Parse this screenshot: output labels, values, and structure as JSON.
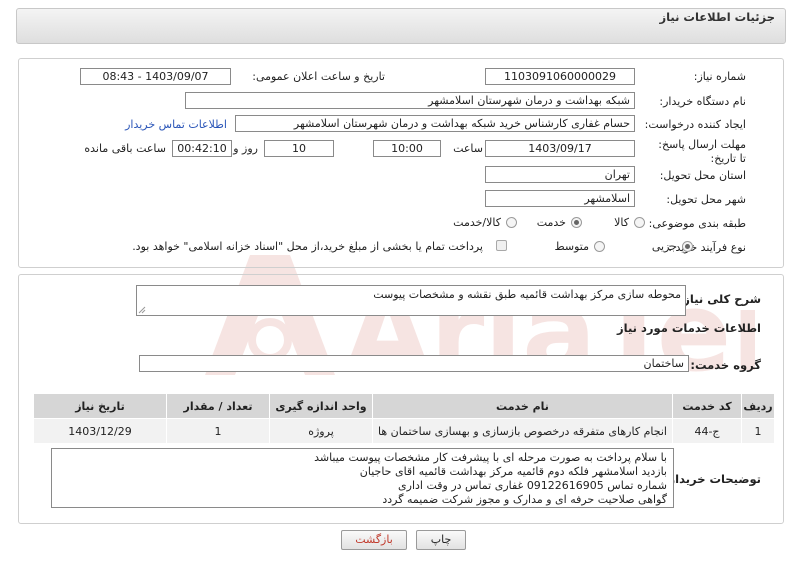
{
  "header": {
    "title": "جزئیات اطلاعات نیاز"
  },
  "form": {
    "need_number_label": "شماره نیاز:",
    "need_number": "1103091060000029",
    "announce_label": "تاریخ و ساعت اعلان عمومی:",
    "announce_value": "1403/09/07 - 08:43",
    "buyer_label": "نام دستگاه خریدار:",
    "buyer_value": "شبکه بهداشت و درمان شهرستان اسلامشهر",
    "creator_label": "ایجاد کننده درخواست:",
    "creator_value": "حسام غفاری کارشناس خرید شبکه بهداشت و درمان شهرستان اسلامشهر",
    "contact_link": "اطلاعات تماس خریدار",
    "deadline_label": "مهلت ارسال پاسخ: تا تاریخ:",
    "deadline_date": "1403/09/17",
    "time_label": "ساعت",
    "deadline_time": "10:00",
    "days_value": "10",
    "days_label": "روز و",
    "remaining_value": "00:42:10",
    "remaining_label": "ساعت باقی مانده",
    "province_label": "استان محل تحویل:",
    "province_value": "تهران",
    "city_label": "شهر محل تحویل:",
    "city_value": "اسلامشهر",
    "category_label": "طبقه بندی موضوعی:",
    "category_options": [
      "کالا",
      "خدمت",
      "کالا/خدمت"
    ],
    "category_selected": "خدمت",
    "process_label": "نوع فرآیند خرید :",
    "process_options": [
      "جزیی",
      "متوسط"
    ],
    "process_selected": "جزیی",
    "payment_note": "پرداخت تمام یا بخشی از مبلغ خرید،از محل \"اسناد خزانه اسلامی\" خواهد بود."
  },
  "summary": {
    "label": "شرح کلی نیاز:",
    "value": "محوطه سازی مرکز بهداشت قائمیه طبق نقشه و مشخصات پیوست"
  },
  "services": {
    "section_title": "اطلاعات خدمات مورد نیاز",
    "group_label": "گروه خدمت:",
    "group_value": "ساختمان",
    "columns": [
      "ردیف",
      "کد خدمت",
      "نام خدمت",
      "واحد اندازه گیری",
      "تعداد / مقدار",
      "تاریخ نیاز"
    ],
    "rows": [
      [
        "1",
        "ج-44",
        "انجام کارهای متفرقه درخصوص بازسازی و بهسازی ساختمان ها",
        "پروژه",
        "1",
        "1403/12/29"
      ]
    ]
  },
  "buyer_notes": {
    "label": "توضیحات خریدار:",
    "lines": [
      "با سلام پرداخت به صورت مرحله ای با پیشرفت کار مشخصات پیوست میباشد",
      "بازدید اسلامشهر فلکه دوم قائمیه مرکز بهداشت قائمیه اقای حاجیان",
      "شماره تماس 09122616905 غفاری تماس در وقت اداری",
      "گواهی صلاحیت حرفه ای و مدارک و مجوز شرکت ضمیمه گردد"
    ]
  },
  "buttons": {
    "print": "چاپ",
    "back": "بازگشت"
  }
}
